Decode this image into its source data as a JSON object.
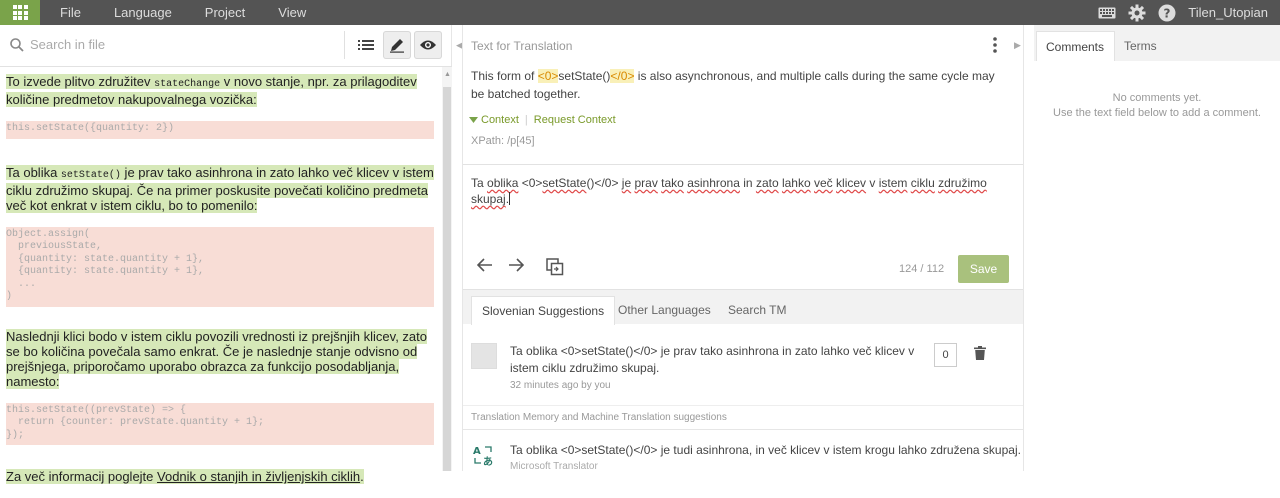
{
  "topbar": {
    "menu": [
      "File",
      "Language",
      "Project",
      "View"
    ],
    "user": "Tilen_Utopian"
  },
  "left": {
    "search_placeholder": "Search in file",
    "p1_pre": "To izvede plitvo združitev ",
    "p1_code": "stateChange",
    "p1_post": " v novo stanje, npr. za prilagoditev količine predmetov nakupovalnega vozička:",
    "code1": "this.setState({quantity: 2})",
    "p2_pre": "Ta oblika ",
    "p2_code": "setState()",
    "p2_post": " je prav tako asinhrona in zato lahko več klicev v istem ciklu združimo skupaj. Če na primer poskusite povečati količino predmeta več kot enkrat v istem ciklu, bo to pomenilo:",
    "code2": "Object.assign(\n  previousState,\n  {quantity: state.quantity + 1},\n  {quantity: state.quantity + 1},\n  ...\n)",
    "p3": "Naslednji klici bodo v istem ciklu povozili vrednosti iz prejšnjih klicev, zato se bo količina povečala samo enkrat. Če je naslednje stanje odvisno od prejšnjega, priporočamo uporabo obrazca za funkcijo posodabljanja, namesto:",
    "code3": "this.setState((prevState) => {\n  return {counter: prevState.quantity + 1};\n});",
    "p4_pre": "Za več informacij poglejte ",
    "p4_link": "Vodnik o stanjih in življenjskih ciklih",
    "p4_post": "."
  },
  "mid": {
    "title": "Text for Translation",
    "source_pre": "This form of ",
    "source_tag1": "<0>",
    "source_mid": "setState()",
    "source_tag2": "</0>",
    "source_post": " is also asynchronous, and multiple calls during the same cycle may be batched together.",
    "context_label": "Context",
    "request_context": "Request Context",
    "xpath": "XPath: /p[45]",
    "editor": {
      "w1": "Ta ",
      "w2": "oblika",
      "w3": " <0>",
      "w4": "setState",
      "w5": "()</0> ",
      "w6": "je",
      "w7": " ",
      "w8": "prav",
      "w9": " ",
      "w10": "tako",
      "w11": " ",
      "w12": "asinhrona",
      "w13": " in ",
      "w14": "zato",
      "w15": " ",
      "w16": "lahko",
      "w17": " ",
      "w18": "več",
      "w19": " ",
      "w20": "klicev",
      "w21": " v ",
      "w22": "istem",
      "w23": " ",
      "w24": "ciklu",
      "w25": " ",
      "w26": "združimo",
      "w27": " ",
      "w28": "skupaj",
      "w29": "."
    },
    "counter": "124 / 112",
    "save": "Save",
    "tabs": [
      "Slovenian Suggestions",
      "Other Languages",
      "Search TM"
    ],
    "suggestion": {
      "text": "Ta oblika <0>setState()</0> je prav tako asinhrona in zato lahko več klicev v istem ciklu združimo skupaj.",
      "meta": "32 minutes ago by you",
      "votes": "0"
    },
    "tm_header": "Translation Memory and Machine Translation suggestions",
    "mt": {
      "text": "Ta oblika <0>setState()</0> je tudi asinhrona, in več klicev v istem krogu lahko združena skupaj.",
      "source": "Microsoft Translator"
    }
  },
  "right": {
    "tabs": [
      "Comments",
      "Terms"
    ],
    "empty_line1": "No comments yet.",
    "empty_line2": "Use the text field below to add a comment."
  },
  "colors": {
    "accent": "#7aa34a",
    "highlight": "#d6e8b8",
    "code_bg": "#f8ddd6",
    "save": "#a9c17d",
    "tag": "#f9f0b8"
  }
}
